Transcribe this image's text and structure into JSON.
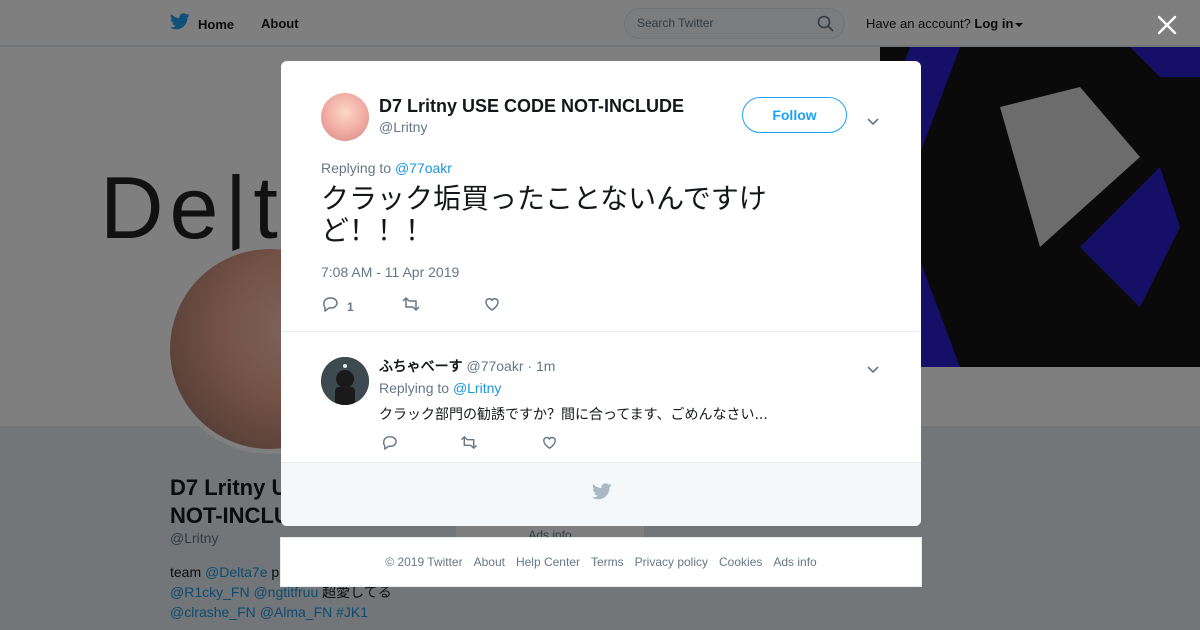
{
  "topnav": {
    "home_label": "Home",
    "about_label": "About",
    "search_placeholder": "Search Twitter",
    "account_prompt": "Have an account?",
    "login_label": "Log in"
  },
  "banner": {
    "text": "De|t"
  },
  "profile": {
    "name": "D7 Lritny USE CODE NOT-INCLUDE",
    "name_visible": "D7 Lritny U NOT-INCLUD",
    "handle": "@Lritny",
    "bio_prefix": "team",
    "bio_link1": "@Delta7e",
    "bio_mid": "p",
    "bio_link2": "@R1cky_FN",
    "bio_link3": "@ngtitfruu",
    "bio_suffix": "超愛してる",
    "bio_link4": "@clrashe_FN",
    "bio_link5": "@Alma_FN",
    "bio_link6": "#JK1",
    "ads_info": "Ads info"
  },
  "tweet": {
    "author_name": "D7 Lritny USE CODE NOT-INCLUDE",
    "author_handle": "@Lritny",
    "follow_label": "Follow",
    "replying_to_label": "Replying to",
    "replying_to_handle": "@77oakr",
    "text": "クラック垢買ったことないんですけど！！！",
    "timestamp": "7:08 AM - 11 Apr 2019",
    "reply_count": "1"
  },
  "reply": {
    "author_name": "ふちゃべーす",
    "author_handle": "@77oakr",
    "separator": "·",
    "age": "1m",
    "replying_to_label": "Replying to",
    "replying_to_handle": "@Lritny",
    "text": "クラック部門の勧誘ですか？間に合ってます、ごめんなさい..."
  },
  "footer": {
    "copyright": "© 2019 Twitter",
    "about": "About",
    "help": "Help Center",
    "terms": "Terms",
    "privacy": "Privacy policy",
    "cookies": "Cookies",
    "ads": "Ads info"
  },
  "colors": {
    "brand": "#1da1f2",
    "link": "#1b95e0",
    "muted": "#657786",
    "text": "#14171a"
  }
}
